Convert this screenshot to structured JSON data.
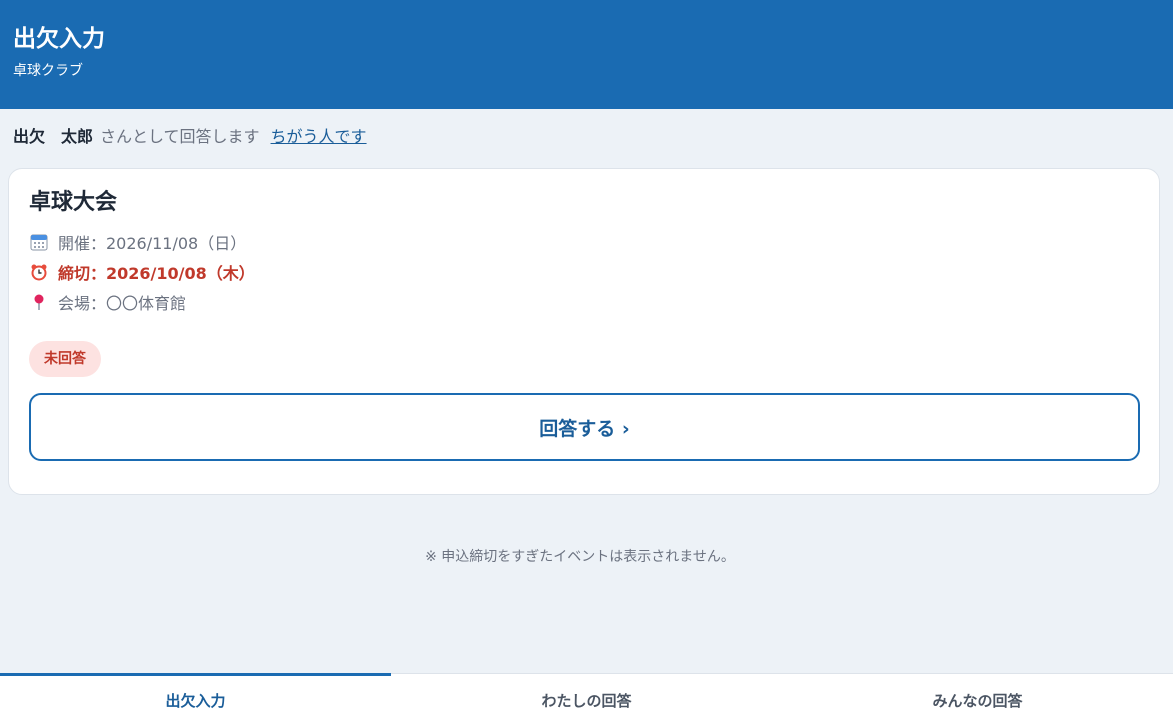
{
  "header": {
    "title": "出欠入力",
    "subtitle": "卓球クラブ"
  },
  "whoami": {
    "name": "出欠　太郎",
    "suffix": "さんとして回答します",
    "switch_label": "ちがう人です"
  },
  "event": {
    "title": "卓球大会",
    "date": "開催：2026/11/08（日）",
    "deadline": "締切：2026/10/08（木）",
    "venue": "会場：〇〇体育館",
    "status_badge": "未回答",
    "answer_button": "回答する ›"
  },
  "note": "※ 申込締切をすぎたイベントは表示されません。",
  "tabs": [
    {
      "label": "出欠入力",
      "active": true
    },
    {
      "label": "わたしの回答",
      "active": false
    },
    {
      "label": "みんなの回答",
      "active": false
    }
  ],
  "colors": {
    "header_bg": "#1a6bb2",
    "accent": "#1a5d99",
    "danger": "#c0392b",
    "badge_bg": "#fde2e1"
  },
  "icons": {
    "date": "calendar-icon",
    "deadline": "alarm-clock-icon",
    "venue": "pin-icon"
  }
}
